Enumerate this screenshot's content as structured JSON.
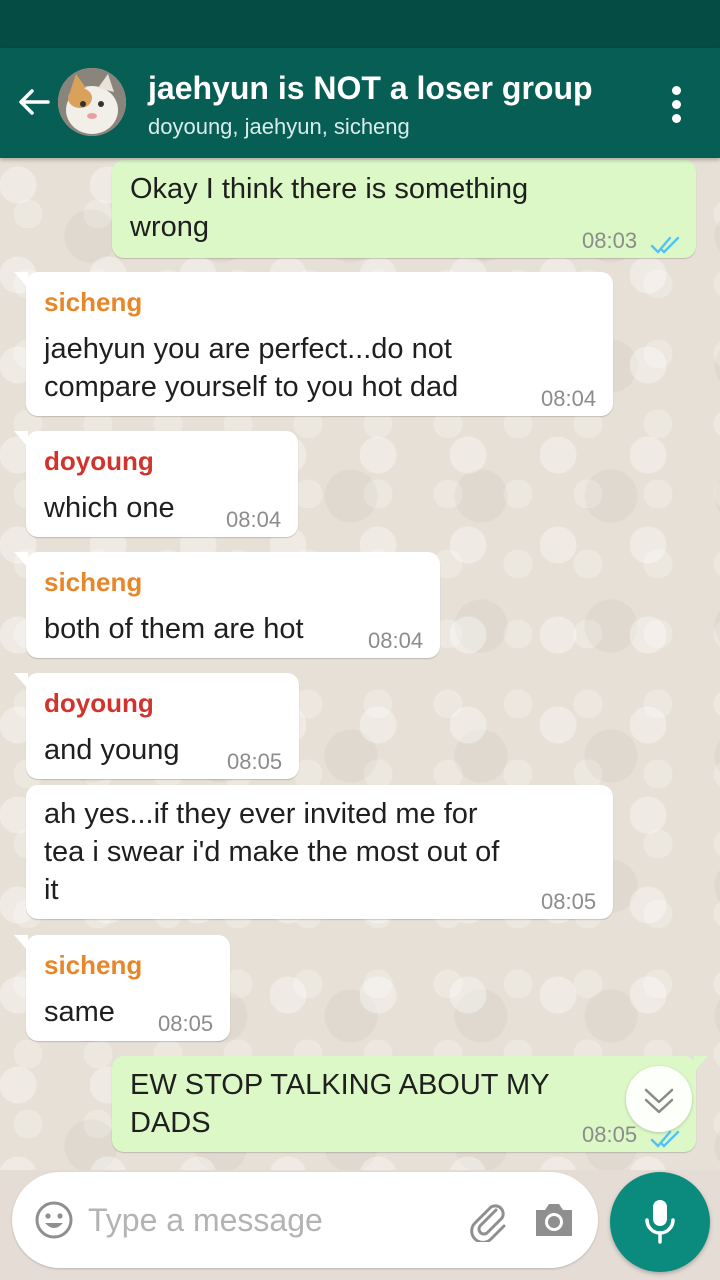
{
  "header": {
    "title": "jaehyun is NOT a loser group",
    "subtitle": "doyoung, jaehyun, sicheng"
  },
  "colors": {
    "header": "#075e54",
    "outgoing_bubble": "#dcf8c6",
    "incoming_bubble": "#ffffff",
    "sicheng": "#e8862a",
    "doyoung": "#d0342c",
    "read_ticks": "#4fc3f7",
    "mic_button": "#0b8a7e"
  },
  "messages": [
    {
      "text_lines": [
        "Okay I think there is something",
        "wrong"
      ],
      "time": "08:03",
      "direction": "out",
      "status": "read"
    },
    {
      "sender": "sicheng",
      "text_lines": [
        "jaehyun you are perfect...do not",
        "compare yourself to you hot dad"
      ],
      "time": "08:04"
    },
    {
      "sender": "doyoung",
      "text_lines": [
        "which one"
      ],
      "time": "08:04"
    },
    {
      "sender": "sicheng",
      "text_lines": [
        "both of them are hot"
      ],
      "time": "08:04"
    },
    {
      "sender": "doyoung",
      "text_lines": [
        "and young"
      ],
      "time": "08:05"
    },
    {
      "text_lines": [
        "ah yes...if they ever invited me for",
        "tea i swear i'd make the most out of",
        "it"
      ],
      "time": "08:05"
    },
    {
      "sender": "sicheng",
      "text_lines": [
        "same"
      ],
      "time": "08:05"
    },
    {
      "text_lines": [
        "EW STOP TALKING ABOUT MY",
        "DADS"
      ],
      "time": "08:05",
      "direction": "out",
      "status": "read"
    }
  ],
  "composer": {
    "placeholder": "Type a message"
  },
  "icons": [
    "back-arrow-icon",
    "avatar",
    "more-vert-icon",
    "read-ticks-icon",
    "scroll-down-chevron-icon",
    "emoji-icon",
    "attach-icon",
    "camera-icon",
    "mic-icon"
  ]
}
